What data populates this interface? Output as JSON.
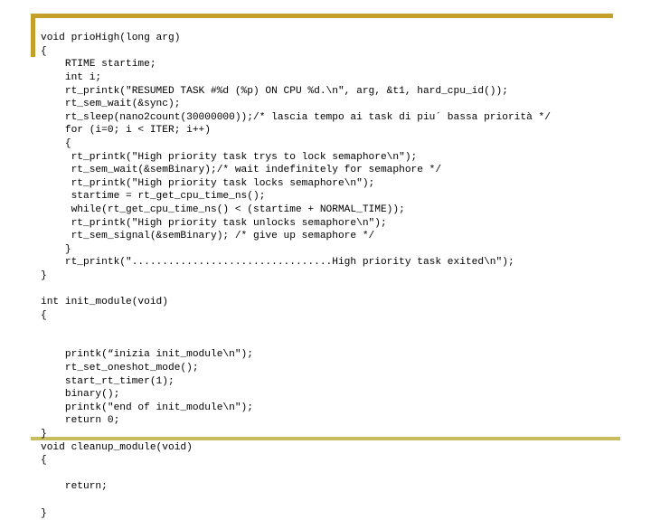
{
  "slide": {
    "kind": "code-listing-slide",
    "background_color": "#ffffff",
    "decorations": {
      "top_rule_color": "#c3a02a",
      "left_rule_color": "#c3a02a",
      "bottom_rule_color": "#c8bc5c"
    }
  },
  "code": {
    "language": "c",
    "text_color": "#000000",
    "lines": [
      "void prioHigh(long arg)",
      "{",
      "    RTIME startime;",
      "    int i;",
      "    rt_printk(\"RESUMED TASK #%d (%p) ON CPU %d.\\n\", arg, &t1, hard_cpu_id());",
      "    rt_sem_wait(&sync);",
      "    rt_sleep(nano2count(30000000));/* lascia tempo ai task di piu´ bassa priorità */",
      "    for (i=0; i < ITER; i++)",
      "    {",
      "     rt_printk(\"High priority task trys to lock semaphore\\n\");",
      "     rt_sem_wait(&semBinary);/* wait indefinitely for semaphore */",
      "     rt_printk(\"High priority task locks semaphore\\n\");",
      "     startime = rt_get_cpu_time_ns();",
      "     while(rt_get_cpu_time_ns() < (startime + NORMAL_TIME));",
      "     rt_printk(\"High priority task unlocks semaphore\\n\");",
      "     rt_sem_signal(&semBinary); /* give up semaphore */",
      "    }",
      "    rt_printk(\".................................High priority task exited\\n\");",
      "}",
      "",
      "int init_module(void)",
      "{",
      "",
      "",
      "    printk(“inizia init_module\\n\");",
      "    rt_set_oneshot_mode();",
      "    start_rt_timer(1);",
      "    binary();",
      "    printk(\"end of init_module\\n\");",
      "    return 0;",
      "}",
      "void cleanup_module(void)",
      "{",
      "",
      "    return;",
      "",
      "}"
    ]
  }
}
